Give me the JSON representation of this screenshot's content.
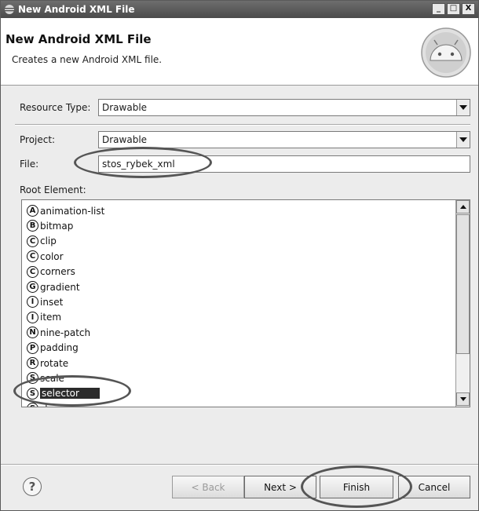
{
  "window": {
    "title": "New Android XML File",
    "controls": {
      "minimize": "_",
      "maximize": "□",
      "close": "X"
    }
  },
  "header": {
    "title": "New Android XML File",
    "description": "Creates a new Android XML file.",
    "logo_icon": "android-logo"
  },
  "form": {
    "resource_type": {
      "label": "Resource Type:",
      "value": "Drawable"
    },
    "project": {
      "label": "Project:",
      "value": "Drawable"
    },
    "file": {
      "label": "File:",
      "value": "stos_rybek_xml"
    },
    "root_element": {
      "label": "Root Element:"
    }
  },
  "root_elements": [
    {
      "badge": "A",
      "label": "animation-list"
    },
    {
      "badge": "B",
      "label": "bitmap"
    },
    {
      "badge": "C",
      "label": "clip"
    },
    {
      "badge": "C",
      "label": "color"
    },
    {
      "badge": "C",
      "label": "corners"
    },
    {
      "badge": "G",
      "label": "gradient"
    },
    {
      "badge": "I",
      "label": "inset"
    },
    {
      "badge": "I",
      "label": "item"
    },
    {
      "badge": "N",
      "label": "nine-patch"
    },
    {
      "badge": "P",
      "label": "padding"
    },
    {
      "badge": "R",
      "label": "rotate"
    },
    {
      "badge": "S",
      "label": "scale"
    },
    {
      "badge": "S",
      "label": "selector",
      "selected": true
    },
    {
      "badge": "S",
      "label": "shape"
    }
  ],
  "buttons": {
    "help": "?",
    "back": "< Back",
    "next": "Next >",
    "finish": "Finish",
    "cancel": "Cancel"
  },
  "colors": {
    "selection_bg": "#2b2b2b",
    "annotation": "#555555"
  }
}
